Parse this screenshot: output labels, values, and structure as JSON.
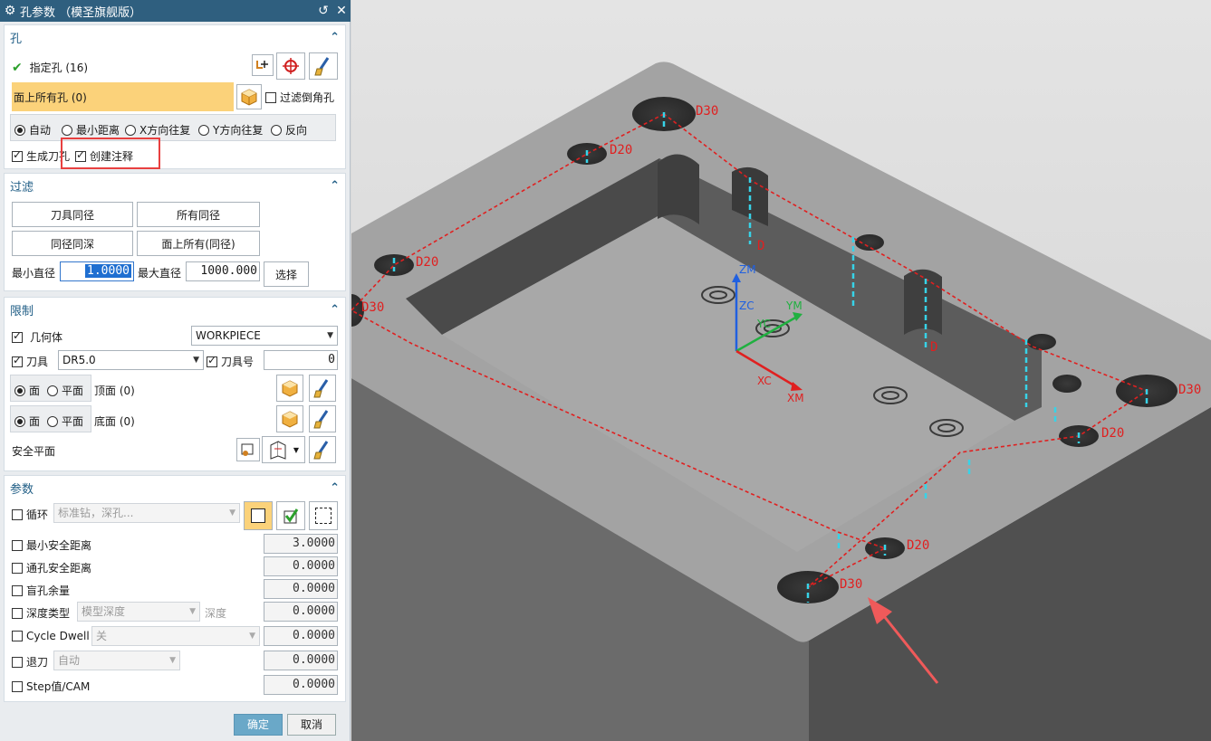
{
  "dialog": {
    "title": "孔参数 （模圣旗舰版）",
    "title_icons": {
      "left": "gear-icon",
      "reset": "reset-icon",
      "close": "close-icon"
    }
  },
  "hole_section": {
    "title": "孔",
    "specify_hole": "指定孔 (16)",
    "all_holes_on_face": "面上所有孔 (0)",
    "filter_chamfer_label": "过滤倒角孔",
    "filter_chamfer_checked": false,
    "order_options": [
      "自动",
      "最小距离",
      "X方向往复",
      "Y方向往复",
      "反向"
    ],
    "order_selected": "自动",
    "gen_tool_label": "生成刀孔",
    "gen_tool_checked": true,
    "create_note_label": "创建注释",
    "create_note_checked": true
  },
  "filter_section": {
    "title": "过滤",
    "buttons": [
      "刀具同径",
      "所有同径",
      "同径同深",
      "面上所有(同径)"
    ],
    "min_diameter_label": "最小直径",
    "min_diameter_value": "1.0000",
    "max_diameter_label": "最大直径",
    "max_diameter_value": "1000.000",
    "select_button": "选择"
  },
  "limit_section": {
    "title": "限制",
    "geometry_label": "几何体",
    "geometry_value": "WORKPIECE",
    "tool_label": "刀具",
    "tool_value": "DR5.0",
    "tool_number_label": "刀具号",
    "tool_number_value": "0",
    "face_label": "面",
    "plane_label": "平面",
    "top_face": "顶面 (0)",
    "bottom_face": "底面 (0)",
    "safe_plane": "安全平面"
  },
  "params_section": {
    "title": "参数",
    "cycle_label": "循环",
    "cycle_value": "标准钻，深孔...",
    "min_safe_label": "最小安全距离",
    "min_safe_value": "3.0000",
    "through_safe_label": "通孔安全距离",
    "through_safe_value": "0.0000",
    "blind_stock_label": "盲孔余量",
    "blind_stock_value": "0.0000",
    "depth_type_label": "深度类型",
    "depth_type_value": "模型深度",
    "depth_label": "深度",
    "depth_value": "0.0000",
    "dwell_label": "Cycle Dwell",
    "dwell_value": "关",
    "dwell_num": "0.0000",
    "retract_label": "退刀",
    "retract_value": "自动",
    "retract_num": "0.0000",
    "step_label": "Step值/CAM",
    "step_value": "0.0000"
  },
  "footer": {
    "ok": "确定",
    "cancel": "取消"
  },
  "viewport": {
    "hole_labels": [
      "D30",
      "D20",
      "D",
      "D20",
      "D30",
      "D",
      "D30",
      "D20",
      "D20",
      "D30"
    ],
    "axis_labels": {
      "zm": "ZM",
      "zc": "ZC",
      "ym": "YM",
      "yc": "YC",
      "xc": "XC",
      "xm": "XM"
    },
    "colors": {
      "highlight": "#e84040",
      "tool_marker": "#37d3e8",
      "path": "#e02020",
      "plate_top": "#a3a3a3"
    }
  }
}
